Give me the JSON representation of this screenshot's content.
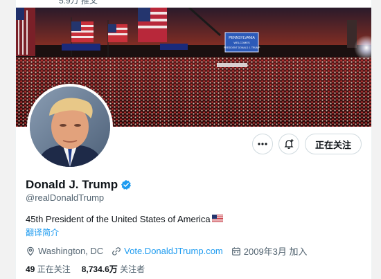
{
  "profile": {
    "tweets_count": "5.9万 推文",
    "name": "Donald J. Trump",
    "handle": "@realDonaldTrump",
    "bio": "45th President of the United States of America",
    "translate_label": "翻译简介",
    "location": "Washington, DC",
    "website": "Vote.DonaldJTrump.com",
    "joined": "2009年3月 加入",
    "following_count": "49",
    "following_label": "正在关注",
    "followers_count": "8,734.6万",
    "followers_label": "关注者"
  },
  "actions": {
    "follow_label": "正在关注",
    "more_icon": "more-horizontal-icon",
    "notify_icon": "bell-plus-icon"
  },
  "icons": {
    "verified": "verified-badge-icon",
    "location": "location-pin-icon",
    "link": "link-icon",
    "calendar": "calendar-icon",
    "flag": "us-flag-icon"
  },
  "colors": {
    "accent": "#1d9bf0",
    "text": "#0f1419",
    "secondary": "#536471",
    "border": "#cfd9de"
  },
  "banner": {
    "sign_primary": "PENNSYLVANIA",
    "sign_secondary": "WELCOMES",
    "sign_tertiary": "PRESIDENT DONALD J. TRUMP"
  }
}
